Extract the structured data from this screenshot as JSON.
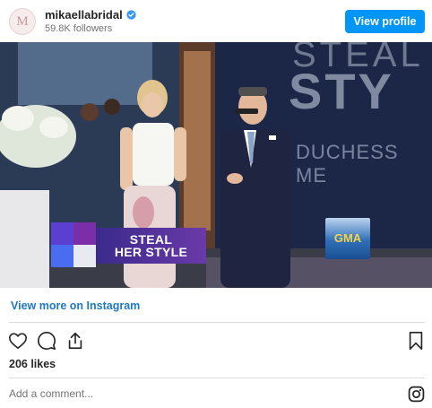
{
  "header": {
    "avatar_letter": "M",
    "username": "mikaellabridal",
    "followers": "59.8K followers",
    "view_profile_label": "View profile"
  },
  "media": {
    "lower_third_line1": "STEAL",
    "lower_third_line2": "HER STYLE",
    "backdrop_top": "STEAL",
    "backdrop_big": "STY",
    "backdrop_sub": "DUCHESS ME",
    "gma_logo": "GMA"
  },
  "footer": {
    "view_more_label": "View more on Instagram",
    "likes": "206 likes",
    "comment_placeholder": "Add a comment..."
  },
  "colors": {
    "accent": "#0095f6",
    "link": "#1e78c2"
  },
  "icons": {
    "like": "heart-icon",
    "comment": "comment-icon",
    "share": "share-icon",
    "save": "bookmark-icon",
    "instagram": "instagram-icon"
  }
}
